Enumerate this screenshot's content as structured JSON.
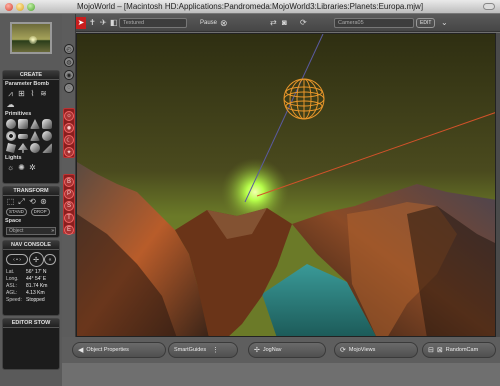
{
  "window": {
    "title": "MojoWorld – [Macintosh HD:Applications:Pandromeda:MojoWorld3:Libraries:Planets:Europa.mjw]"
  },
  "toolbar": {
    "render_mode": "Textured",
    "pause_label": "Pause",
    "camera_field": "Camera05",
    "edit_label": "EDIT"
  },
  "left_panel": {
    "create": {
      "title": "CREATE",
      "parameter_bomb": "Parameter Bomb",
      "primitives": "Primitives",
      "lights": "Lights"
    },
    "transform": {
      "title": "TRANSFORM",
      "stand_label": "STAND",
      "drop_label": "DROP",
      "space_label": "Space",
      "space_value": "Object"
    },
    "nav_console": {
      "title": "NAV CONSOLE",
      "lat_label": "Lat.",
      "lat_value": "56° 17' N",
      "long_label": "Long.",
      "long_value": "44° 54' E",
      "asl_label": "ASL:",
      "asl_value": "81.74 Km",
      "agl_label": "AGL:",
      "agl_value": "4.13 Km",
      "speed_label": "Speed:",
      "speed_value": "Stopped"
    },
    "editor_stow": {
      "title": "EDITOR STOW"
    }
  },
  "bottom_bar": {
    "object_properties": "Object Properties",
    "smart_guides": "SmartGuides",
    "jog_nav": "JogNav",
    "mojo_views": "MojoViews",
    "random_cam": "RandomCam"
  },
  "colors": {
    "accent_red": "#c81e1e",
    "sky": "#3b3b18",
    "water": "#2a7a78",
    "sun": "#b6ff4a",
    "sphere": "#e8962a"
  }
}
